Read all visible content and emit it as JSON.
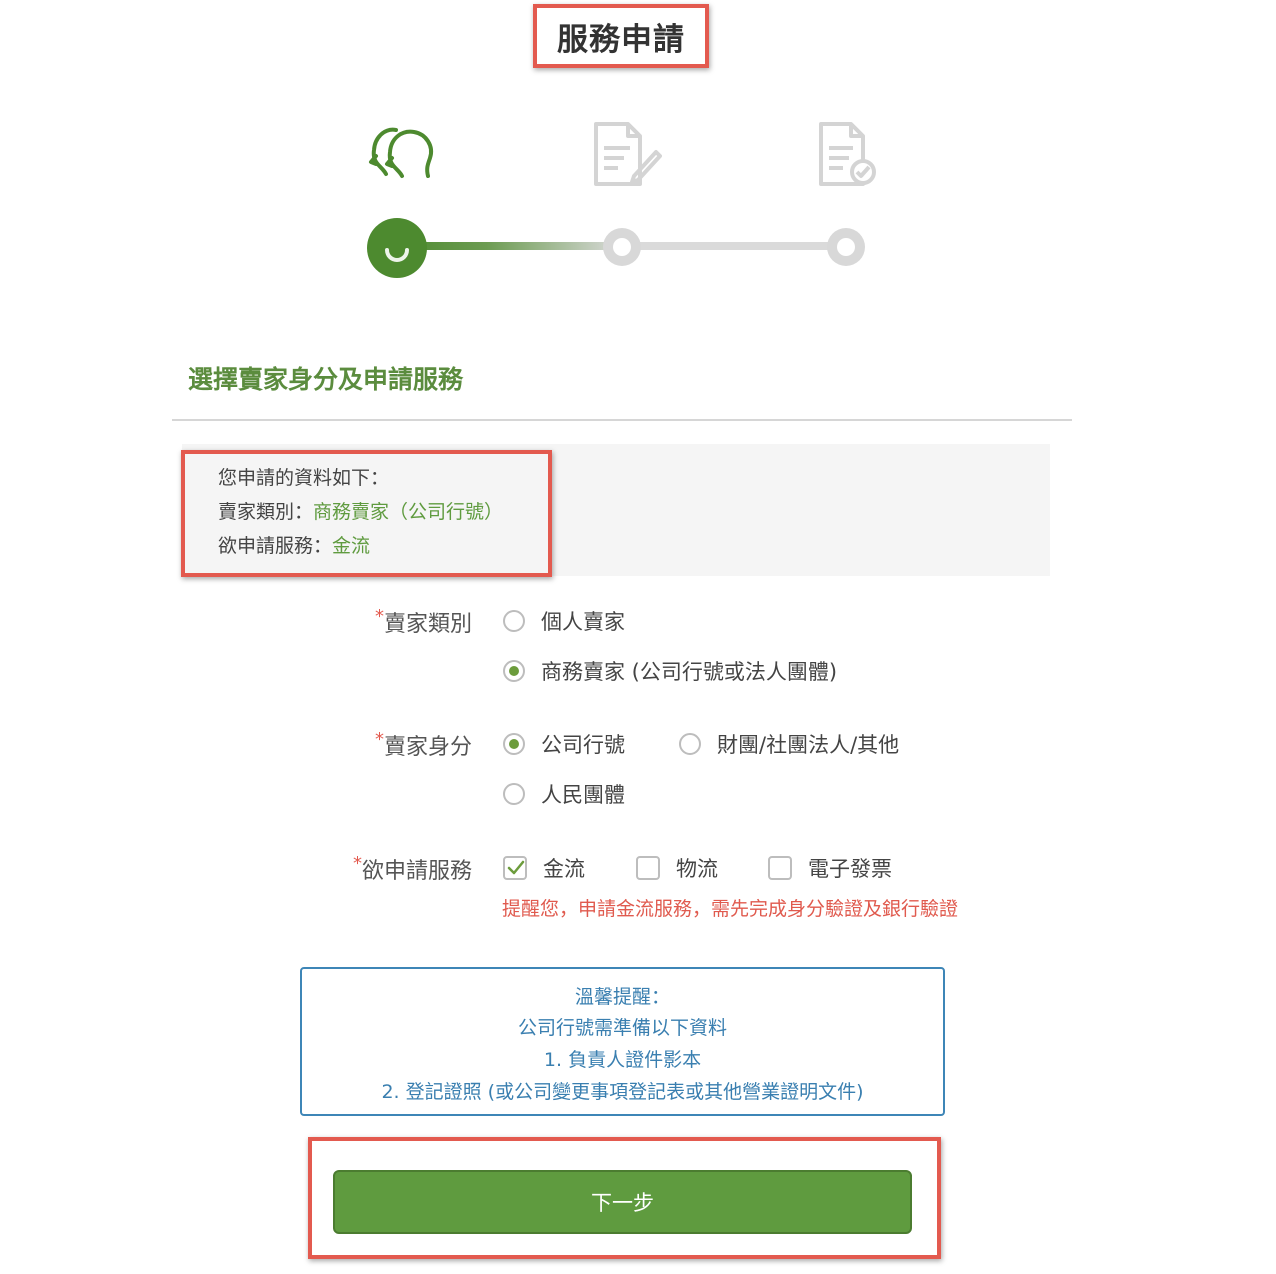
{
  "page": {
    "title": "服務申請"
  },
  "steps": [
    {
      "icon": "seller-identity-icon",
      "state": "active"
    },
    {
      "icon": "fill-form-icon",
      "state": "inactive"
    },
    {
      "icon": "document-verified-icon",
      "state": "inactive"
    }
  ],
  "section": {
    "title": "選擇賣家身分及申請服務"
  },
  "summary": {
    "heading": "您申請的資料如下：",
    "seller_type_label": "賣家類別：",
    "seller_type_value": "商務賣家（公司行號）",
    "service_label": "欲申請服務：",
    "service_value": "金流"
  },
  "form": {
    "required_mark": "*",
    "seller_type": {
      "label": "賣家類別",
      "options": [
        {
          "label": "個人賣家",
          "selected": false
        },
        {
          "label": "商務賣家 (公司行號或法人團體)",
          "selected": true
        }
      ]
    },
    "seller_identity": {
      "label": "賣家身分",
      "options": [
        {
          "label": "公司行號",
          "selected": true
        },
        {
          "label": "財團/社團法人/其他",
          "selected": false
        },
        {
          "label": "人民團體",
          "selected": false
        }
      ]
    },
    "services": {
      "label": "欲申請服務",
      "options": [
        {
          "label": "金流",
          "checked": true
        },
        {
          "label": "物流",
          "checked": false
        },
        {
          "label": "電子發票",
          "checked": false
        }
      ],
      "notice": "提醒您，申請金流服務，需先完成身分驗證及銀行驗證"
    }
  },
  "tips": {
    "title": "溫馨提醒：",
    "lines": [
      "公司行號需準備以下資料",
      "1. 負責人證件影本",
      "2. 登記證照 (或公司變更事項登記表或其他營業證明文件)"
    ]
  },
  "next_button": {
    "label": "下一步"
  },
  "colors": {
    "brand_green": "#5f9b3f",
    "annotation_red": "#e35a4f",
    "tips_blue": "#3a7fb0",
    "notice_red": "#e05a4e"
  }
}
